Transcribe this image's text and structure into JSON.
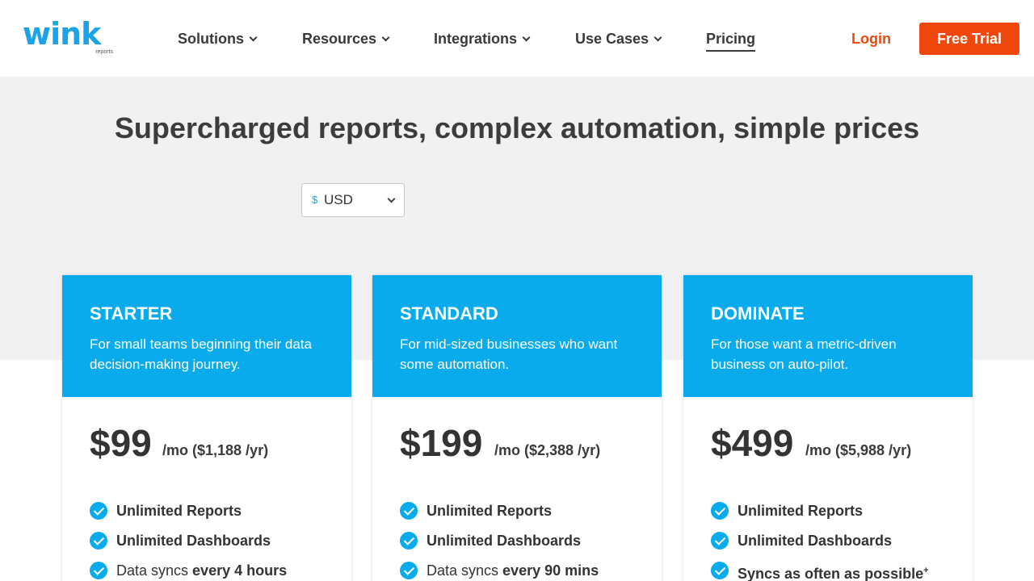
{
  "header": {
    "logo_text": "wink",
    "logo_sub": "reports",
    "nav": [
      {
        "label": "Solutions",
        "dropdown": true
      },
      {
        "label": "Resources",
        "dropdown": true
      },
      {
        "label": "Integrations",
        "dropdown": true
      },
      {
        "label": "Use Cases",
        "dropdown": true
      },
      {
        "label": "Pricing",
        "dropdown": false,
        "active": true
      }
    ],
    "login": "Login",
    "cta": "Free Trial"
  },
  "hero": {
    "headline": "Supercharged reports, complex automation, simple prices",
    "currency": {
      "symbol": "$",
      "selected": "USD"
    }
  },
  "plans": [
    {
      "name": "STARTER",
      "desc": "For small teams beginning their data decision-making journey.",
      "price": "$99",
      "period": "/mo ($1,188 /yr)",
      "features": [
        {
          "text": "Unlimited Reports"
        },
        {
          "text": "Unlimited Dashboards"
        },
        {
          "pre": "Data syncs ",
          "bold": "every 4 hours"
        }
      ]
    },
    {
      "name": "STANDARD",
      "desc": "For mid-sized businesses who want some automation.",
      "price": "$199",
      "period": "/mo ($2,388 /yr)",
      "features": [
        {
          "text": "Unlimited Reports"
        },
        {
          "text": "Unlimited Dashboards"
        },
        {
          "pre": "Data syncs ",
          "bold": "every 90 mins"
        }
      ]
    },
    {
      "name": "DOMINATE",
      "desc": "For those want a metric-driven business on auto-pilot.",
      "price": "$499",
      "period": "/mo ($5,988 /yr)",
      "features": [
        {
          "text": "Unlimited Reports"
        },
        {
          "text": "Unlimited Dashboards"
        },
        {
          "pre": "Syncs as often as possible",
          "sup": "+"
        }
      ]
    }
  ],
  "colors": {
    "brand_blue": "#0aabec",
    "cta_orange": "#f0470c",
    "login_orange": "#ea4a0c"
  },
  "icons": {
    "feature": "check-circle-icon",
    "dropdown": "chevron-down-icon",
    "currency": "dollar-icon"
  }
}
